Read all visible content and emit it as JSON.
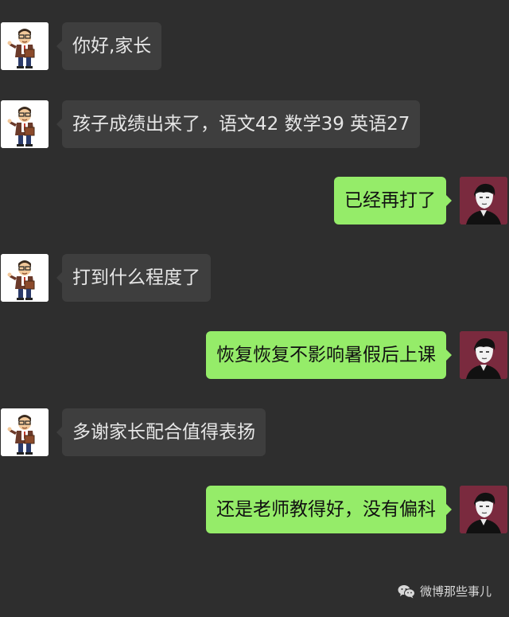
{
  "chat": {
    "messages": [
      {
        "side": "in",
        "text": "你好,家长",
        "avatar": "teacher-cartoon"
      },
      {
        "side": "in",
        "text": "孩子成绩出来了，语文42 数学39 英语27",
        "avatar": "teacher-cartoon"
      },
      {
        "side": "out",
        "text": "已经再打了",
        "avatar": "parent-photo"
      },
      {
        "side": "in",
        "text": "打到什么程度了",
        "avatar": "teacher-cartoon"
      },
      {
        "side": "out",
        "text": "恢复恢复不影响暑假后上课",
        "avatar": "parent-photo"
      },
      {
        "side": "in",
        "text": "多谢家长配合值得表扬",
        "avatar": "teacher-cartoon"
      },
      {
        "side": "out",
        "text": "还是老师教得好，没有偏科",
        "avatar": "parent-photo"
      }
    ]
  },
  "watermark": {
    "icon": "wechat-icon",
    "text": "微博那些事儿"
  },
  "colors": {
    "background": "#2e2e2e",
    "incoming_bubble": "#3e3e3e",
    "outgoing_bubble": "#95ec69"
  }
}
